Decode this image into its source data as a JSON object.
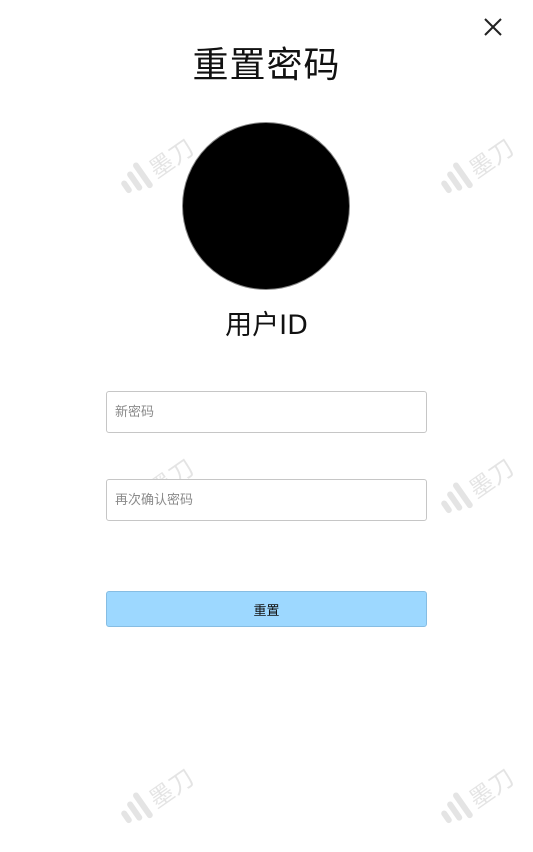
{
  "dialog": {
    "title": "重置密码",
    "user_id_label": "用户ID",
    "close_icon": "close-icon"
  },
  "avatar": {
    "fill_color": "#000000"
  },
  "form": {
    "new_password_placeholder": "新密码",
    "new_password_value": "",
    "confirm_password_placeholder": "再次确认密码",
    "confirm_password_value": "",
    "submit_label": "重置"
  },
  "colors": {
    "submit_background": "#9dd8ff",
    "input_border": "#c6c6c6"
  },
  "watermark": {
    "text": "墨刀",
    "icon": "modao-logo-watermark"
  }
}
